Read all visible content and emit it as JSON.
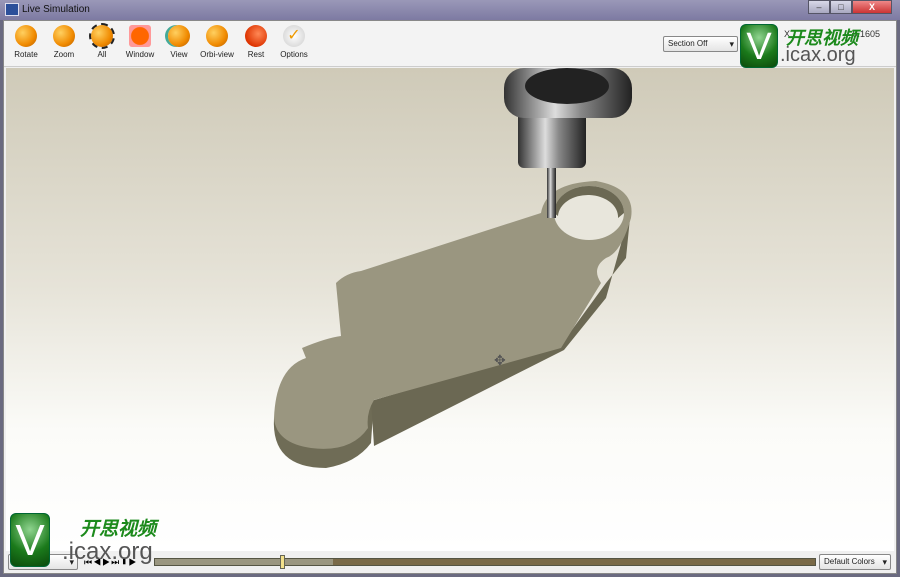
{
  "window": {
    "title": "Live Simulation",
    "minimize": "–",
    "maximize": "□",
    "close": "X"
  },
  "toolbar": {
    "tools": [
      {
        "label": "Rotate",
        "icon": "rotate-icon"
      },
      {
        "label": "Zoom",
        "icon": "zoom-icon"
      },
      {
        "label": "All",
        "icon": "zoom-all-icon"
      },
      {
        "label": "Window",
        "icon": "zoom-window-icon"
      },
      {
        "label": "View",
        "icon": "view-icon"
      },
      {
        "label": "Orbi-view",
        "icon": "orbit-view-icon"
      },
      {
        "label": "Rest",
        "icon": "rest-icon"
      },
      {
        "label": "Options",
        "icon": "options-icon"
      }
    ],
    "section": "Section Off",
    "coord_suffix": "0.1605",
    "coord_prefix": "X"
  },
  "status": {
    "left_select": "",
    "color_mode": "Default Colors",
    "progress": 0.27,
    "playhead": 0.19
  },
  "watermark": {
    "cn": "开思视频",
    "url": ".icax.org",
    "letter": "V"
  }
}
